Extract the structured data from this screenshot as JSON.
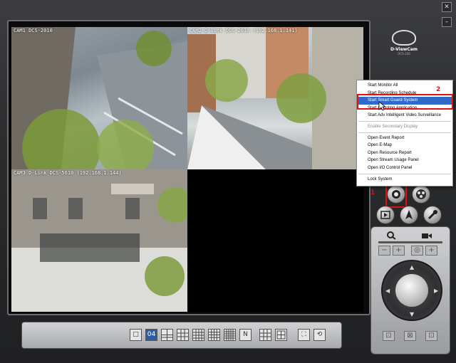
{
  "window": {
    "close_glyph": "✕",
    "minimize_glyph": "–"
  },
  "cameras": [
    {
      "label": "CAM1 DCS-2010"
    },
    {
      "label": "CAM2 D-link DCS-2010 (192.168.1.141)"
    },
    {
      "label": "CAM3 D-Link DCS-5610 (192.168.1.144)"
    },
    {
      "label": ""
    }
  ],
  "logo": {
    "brand": "D-ViewCam",
    "sub": "DCS-100"
  },
  "context_menu": {
    "items": [
      {
        "label": "Start Monitor All",
        "state": "normal"
      },
      {
        "label": "Start Recording Schedule",
        "state": "normal"
      },
      {
        "label": "Start Smart Guard System",
        "state": "selected"
      },
      {
        "label": "Start Counting Application",
        "state": "normal"
      },
      {
        "label": "Start Adv Intelligent Video Surveillance",
        "state": "normal"
      },
      {
        "label": "Enable Secondary Display",
        "state": "disabled"
      },
      {
        "label": "Open Event Report",
        "state": "normal"
      },
      {
        "label": "Open E-Map",
        "state": "normal"
      },
      {
        "label": "Open Resource Report",
        "state": "normal"
      },
      {
        "label": "Open Stream Usage Panel",
        "state": "normal"
      },
      {
        "label": "Open I/O Control Panel",
        "state": "normal"
      },
      {
        "label": "Lock System",
        "state": "normal"
      }
    ]
  },
  "annotations": {
    "step1": "1",
    "step2": "2"
  },
  "toolbar": {
    "layout_04_label": "04",
    "layout_n_label": "N"
  },
  "colors": {
    "highlight": "#e01010",
    "selection": "#3169c6"
  }
}
